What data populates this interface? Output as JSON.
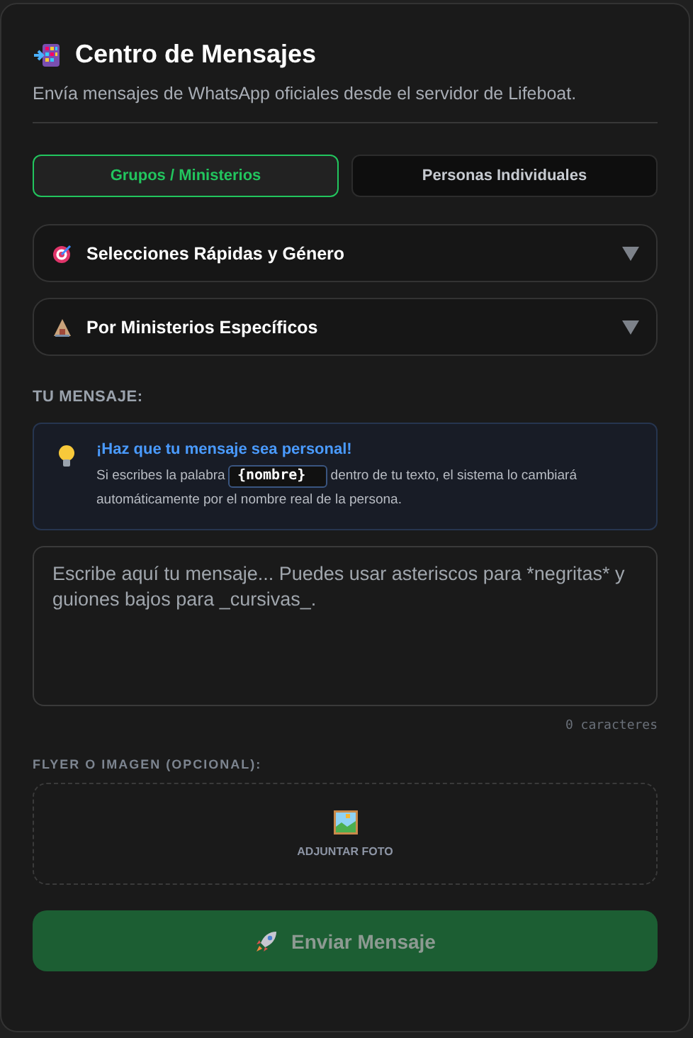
{
  "header": {
    "title": "Centro de Mensajes",
    "subtitle": "Envía mensajes de WhatsApp oficiales desde el servidor de Lifeboat."
  },
  "tabs": [
    {
      "label": "Grupos / Ministerios",
      "selected": true
    },
    {
      "label": "Personas Individuales",
      "selected": false
    }
  ],
  "sections": [
    {
      "kind": "target",
      "label": "Selecciones Rápidas y Género",
      "expanded": false
    },
    {
      "kind": "church",
      "label": "Por Ministerios Específicos",
      "expanded": false
    }
  ],
  "message_label": "TU MENSAJE:",
  "tip": {
    "title": "¡Haz que tu mensaje sea personal!",
    "text_before": "Si escribes la palabra",
    "code": "{nombre}",
    "text_after": "dentro de tu texto, el sistema lo cambiará automáticamente por el nombre real de la persona."
  },
  "message": {
    "placeholder": "Escribe aquí tu mensaje... Puedes usar asteriscos para *negritas* y guiones bajos para _cursivas_.",
    "counter": "0 caracteres"
  },
  "flyer_label": "FLYER O IMAGEN (OPCIONAL):",
  "upload": {
    "label": "ADJUNTAR FOTO"
  },
  "send_button": {
    "label": "Enviar Mensaje",
    "disabled": true
  }
}
